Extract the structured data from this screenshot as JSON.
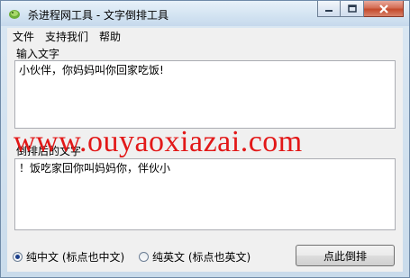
{
  "window": {
    "title": "杀进程网工具 - 文字倒排工具",
    "controls": [
      "minimize",
      "maximize",
      "close"
    ]
  },
  "menu": {
    "items": [
      "文件",
      "支持我们",
      "帮助"
    ]
  },
  "input_section": {
    "label": "输入文字",
    "value": "小伙伴，你妈妈叫你回家吃饭!"
  },
  "output_section": {
    "label": "倒排后的文字",
    "value": "！饭吃家回你叫妈妈你，伴伙小"
  },
  "options": {
    "radio_chinese": {
      "label": "纯中文 (标点也中文)",
      "checked": true
    },
    "radio_english": {
      "label": "纯英文 (标点也英文)",
      "checked": false
    }
  },
  "action_button": {
    "label": "点此倒排"
  },
  "watermark": {
    "text": "www.ouyaoxiazai.com",
    "color": "#e21818"
  }
}
